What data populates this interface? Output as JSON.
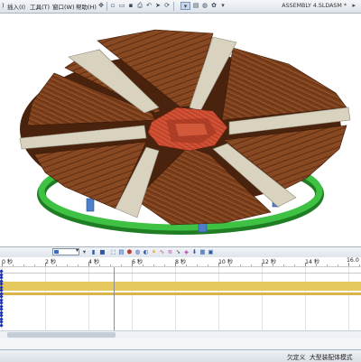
{
  "menubar": {
    "items": [
      "插入(I)",
      "工具(T)",
      "窗口(W)",
      "帮助(H)"
    ]
  },
  "document": {
    "title": "ASSEMBLY 4.SLDASM *"
  },
  "timeline": {
    "ticks": [
      "0 秒",
      "2 秒",
      "4 秒",
      "6 秒",
      "8 秒",
      "10 秒",
      "12 秒",
      "14 秒",
      "16.0"
    ]
  },
  "statusbar": {
    "user": "欠定义",
    "mode": "大型装配体模式"
  },
  "colors": {
    "wood": "#7a3f1c",
    "wood_light": "#a25a2c",
    "slider": "#d8d2be",
    "ring": "#35b23a",
    "blue_parts": "#4f7fc8",
    "center": "#c9472e"
  }
}
